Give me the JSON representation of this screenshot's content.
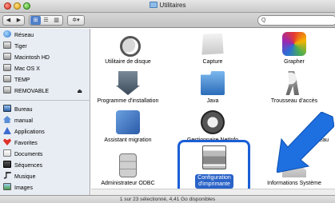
{
  "window": {
    "title": "Utilitaires",
    "search_placeholder": "Q",
    "status": "1 sur 23 sélectionné, 4,41 Go disponibles"
  },
  "toolbar": {
    "back_label": "◀",
    "forward_label": "▶",
    "view_icons": "⊞",
    "view_list": "☰",
    "view_columns": "▥",
    "action_label": "✲▾"
  },
  "sidebar": {
    "devices": [
      {
        "label": "Réseau",
        "icon": "network-icon"
      },
      {
        "label": "Tiger",
        "icon": "disk-icon"
      },
      {
        "label": "Macintosh HD",
        "icon": "disk-icon"
      },
      {
        "label": "Mac OS X",
        "icon": "disk-icon"
      },
      {
        "label": "TEMP",
        "icon": "disk-icon"
      },
      {
        "label": "REMOVABLE",
        "icon": "disk-icon",
        "eject": "⏏"
      }
    ],
    "places": [
      {
        "label": "Bureau",
        "icon": "desktop-icon"
      },
      {
        "label": "manual",
        "icon": "home-icon"
      },
      {
        "label": "Applications",
        "icon": "applications-icon"
      },
      {
        "label": "Favorites",
        "icon": "favorites-icon"
      },
      {
        "label": "Documents",
        "icon": "documents-icon"
      },
      {
        "label": "Séquences",
        "icon": "movies-icon"
      },
      {
        "label": "Musique",
        "icon": "music-icon"
      },
      {
        "label": "Images",
        "icon": "pictures-icon"
      }
    ]
  },
  "items": [
    {
      "label": "Utilitaire de disque",
      "icon": "disk-utility-icon"
    },
    {
      "label": "Capture",
      "icon": "capture-icon"
    },
    {
      "label": "Grapher",
      "icon": "grapher-icon"
    },
    {
      "label": "Programme d'installation",
      "icon": "installer-icon"
    },
    {
      "label": "Java",
      "icon": "java-folder-icon"
    },
    {
      "label": "Trousseau d'accès",
      "icon": "keychain-icon"
    },
    {
      "label": "Assistant migration",
      "icon": "migration-icon"
    },
    {
      "label": "Gestionnaire NetInfo",
      "icon": "netinfo-icon"
    },
    {
      "label": "le réseau",
      "icon": "network-utility-icon"
    },
    {
      "label": "Administrateur ODBC",
      "icon": "odbc-icon"
    },
    {
      "label_line1": "Configuration",
      "label_line2": "d'imprimante",
      "icon": "printer-setup-icon",
      "selected": true
    },
    {
      "label": "Informations Système",
      "icon": "system-profiler-icon"
    }
  ],
  "colors": {
    "selection": "#2a63c8",
    "highlight_box": "#1a5fd6",
    "arrow": "#1e6fe0"
  }
}
